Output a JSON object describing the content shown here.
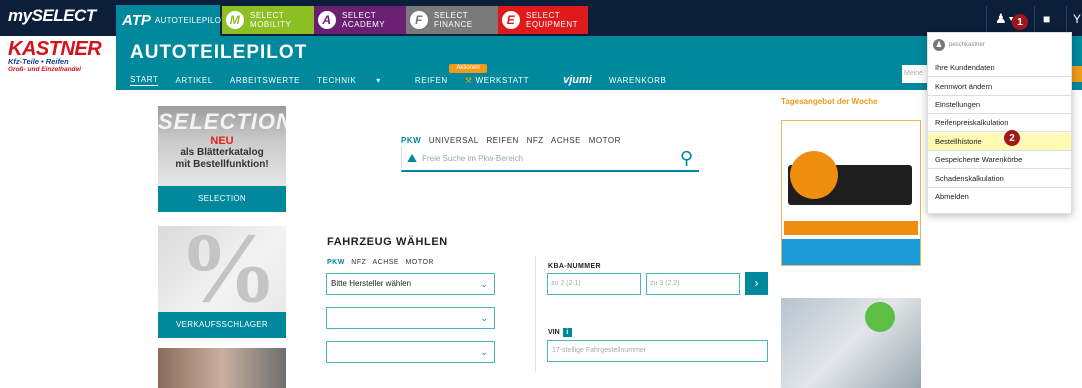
{
  "topbar": {
    "myselect_label": "mySELECT",
    "tabs": [
      {
        "big": "ATP",
        "label": "AUTOTEILEPILOT"
      },
      {
        "icon": "M",
        "line1": "SELECT",
        "line2": "MOBILITY",
        "color": "#8bbf23"
      },
      {
        "icon": "A",
        "line1": "SELECT",
        "line2": "ACADEMY",
        "color": "#6b1f73"
      },
      {
        "icon": "F",
        "line1": "SELECT",
        "line2": "FINANCE",
        "color": "#7a7a7a"
      },
      {
        "icon": "E",
        "line1": "SELECT",
        "line2": "EQUIPMENT",
        "color": "#e01a1a"
      }
    ],
    "user_icon": "user-icon",
    "chat_icon": "chat-icon",
    "step_1": "1"
  },
  "logo": {
    "name": "KASTNER",
    "line2": "Kfz-Teile • Reifen",
    "line3": "Groß- und Einzelhandel"
  },
  "header": {
    "title": "AUTOTEILEPILOT",
    "nav": [
      "START",
      "ARTIKEL",
      "ARBEITSWERTE",
      "TECHNIK",
      "REIFEN",
      "WERKSTATT",
      "vjumi",
      "WARENKORB"
    ],
    "nav_chevron": "▾",
    "werkstatt_badge": "Aktionen",
    "search_placeholder": "Meine"
  },
  "left": {
    "selection_title": "SELECTION",
    "selection_neu": "NEU",
    "selection_line1": "als Blätterkatalog",
    "selection_line2": "mit Bestellfunktion!",
    "selection_button": "SELECTION",
    "pct_symbol": "%",
    "verkauf_button": "VERKAUFSSCHLAGER"
  },
  "search": {
    "types": [
      "PKW",
      "UNIVERSAL",
      "REIFEN",
      "NFZ",
      "ACHSE",
      "MOTOR"
    ],
    "placeholder": "Freie Suche im Pkw-Bereich"
  },
  "vehicle": {
    "title": "FAHRZEUG WÄHLEN",
    "types": [
      "PKW",
      "NFZ",
      "ACHSE",
      "MOTOR"
    ],
    "select1": "Bitte Hersteller wählen",
    "select2": "",
    "select3": "",
    "kba_label": "KBA-NUMMER",
    "kba1_placeholder": "zu 2 (2.1)",
    "kba2_placeholder": "zu 3 (2.2)",
    "vin_label": "VIN",
    "vin_info": "i",
    "vin_placeholder": "17-stellige Fahrgestellnummer"
  },
  "right": {
    "tagesangebot": "Tagesangebot der Woche"
  },
  "dropdown": {
    "username": "peschkastner",
    "items": [
      "Ihre Kundendaten",
      "Kennwort ändern",
      "Einstellungen",
      "Reifenpreiskalkulation",
      "Bestellhistorie",
      "Gespeicherte Warenkörbe",
      "Schadenskalkulation",
      "Abmelden"
    ],
    "highlighted_index": 4,
    "step_2": "2",
    "highlight_color": "#fef9b3"
  },
  "colors": {
    "topbar": "#0b1e3a",
    "teal": "#00889d",
    "orange": "#f29a1b",
    "step_marker": "#a0161b"
  }
}
